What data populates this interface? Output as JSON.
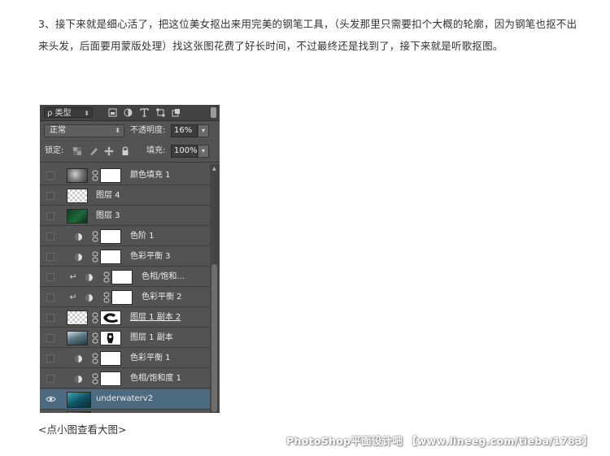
{
  "article": {
    "paragraph": "3、接下来就是细心活了，把这位美女抠出来用完美的钢笔工具，（头发那里只需要扣个大概的轮廓，因为钢笔也抠不出来头发，后面要用蒙版处理）找这张图花费了好长时间，不过最终还是找到了，接下来就是听歌抠图。",
    "caption": "<点小图查看大图>"
  },
  "layers_panel": {
    "filter_kind": "ρ 类型",
    "blend_mode": "正常",
    "opacity_label": "不透明度:",
    "opacity_value": "16%",
    "lock_label": "锁定:",
    "fill_label": "填充:",
    "fill_value": "100%",
    "layers": [
      {
        "name": "颜色填充 1",
        "thumb": "smoke",
        "mask": true
      },
      {
        "name": "图层 4",
        "thumb": "checker",
        "mask": false
      },
      {
        "name": "图层 3",
        "thumb": "green",
        "mask": false
      },
      {
        "name": "色阶 1",
        "thumb": "adjust",
        "mask": true
      },
      {
        "name": "色彩平衡 3",
        "thumb": "adjust",
        "mask": true
      },
      {
        "name": "色相/饱和...",
        "thumb": "adjust",
        "mask": true,
        "clipped": true
      },
      {
        "name": "色彩平衡 2",
        "thumb": "adjust",
        "mask": true,
        "clipped": true
      },
      {
        "name": "图层 1 副本 2",
        "thumb": "checker",
        "mask": true,
        "underlined": true
      },
      {
        "name": "图层 1 副本",
        "thumb": "photo",
        "mask": true
      },
      {
        "name": "色彩平衡 1",
        "thumb": "adjust",
        "mask": true
      },
      {
        "name": "色相/饱和度 1",
        "thumb": "adjust",
        "mask": true
      },
      {
        "name": "underwaterv2",
        "thumb": "under",
        "mask": false,
        "selected": true,
        "visible": true
      }
    ]
  },
  "watermark": "PhotoShop平面设计吧 【www.lineeg.com/tieba/1783】",
  "colors": {
    "panel_bg": "#535353",
    "selected_row": "#4c6a80",
    "text": "#333333"
  }
}
